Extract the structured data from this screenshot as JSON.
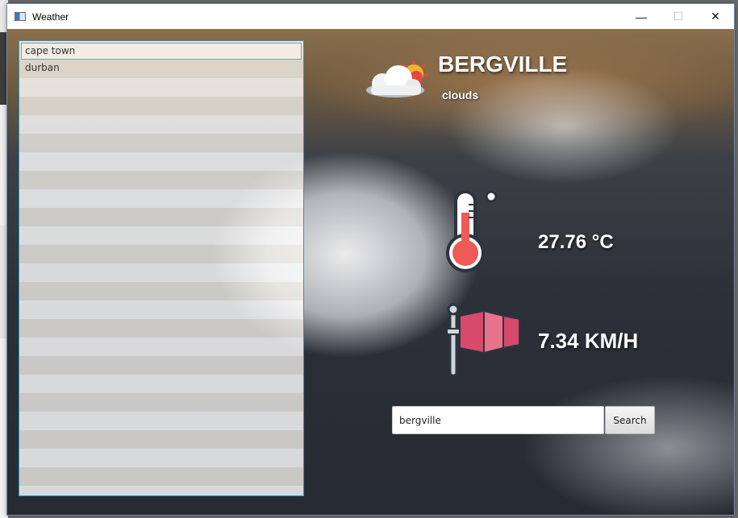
{
  "window": {
    "title": "Weather",
    "minimize_glyph": "—",
    "maximize_glyph": "☐",
    "close_glyph": "✕"
  },
  "city_list": {
    "items": [
      {
        "label": "cape town",
        "selected": true
      },
      {
        "label": "durban",
        "selected": false
      }
    ]
  },
  "weather": {
    "city": "BERGVILLE",
    "description": "clouds",
    "temperature": "27.76 °C",
    "wind_speed": "7.34 KM/H",
    "condition_icon": "partly-cloudy-icon",
    "temp_icon": "thermometer-icon",
    "wind_icon": "windsock-icon"
  },
  "search": {
    "value": "bergville",
    "button_label": "Search"
  },
  "colors": {
    "list_border": "#1d9fc4",
    "thermo_red": "#ee5a55",
    "windsock_pink": "#d9496b"
  }
}
